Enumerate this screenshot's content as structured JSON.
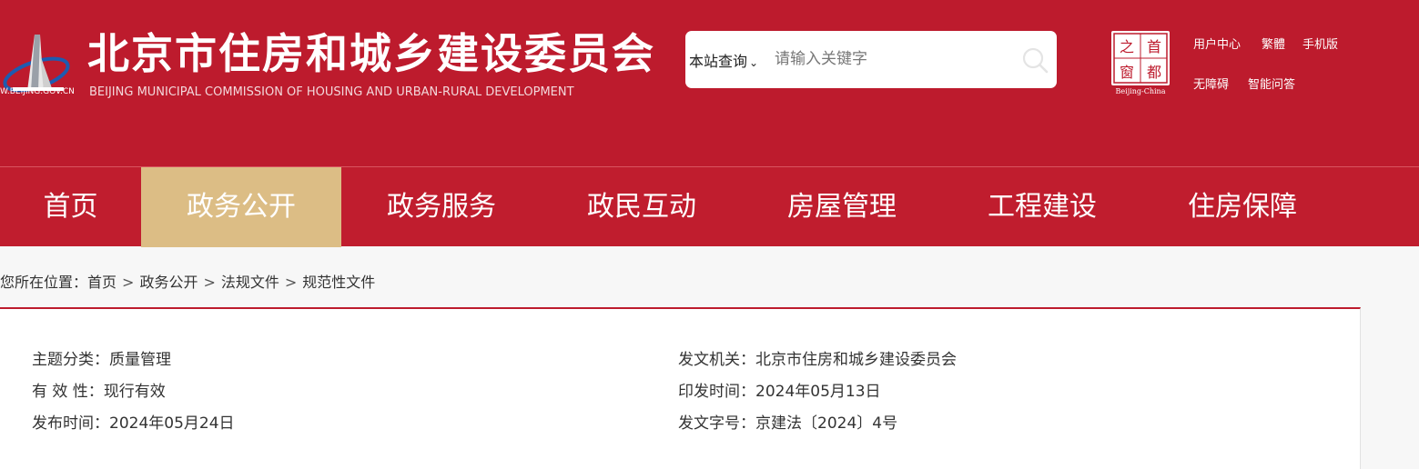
{
  "header": {
    "title": "北京市住房和城乡建设委员会",
    "subtitle": "BEIJING MUNICIPAL COMMISSION OF HOUSING AND URBAN-RURAL DEVELOPMENT",
    "emblem_url": "W.BEIJING.GOV.CN",
    "colors": {
      "brand": "#bd1b2d",
      "nav_active": "#dcbd85"
    }
  },
  "search": {
    "scope_label": "本站查询",
    "placeholder": "请输入关键字"
  },
  "capital_badge": {
    "chars": [
      "之",
      "首",
      "窗",
      "都"
    ],
    "caption": "Beijing-China"
  },
  "top_links": [
    "用户中心",
    "繁體",
    "手机版",
    "无障碍",
    "智能问答"
  ],
  "nav": {
    "items": [
      "首页",
      "政务公开",
      "政务服务",
      "政民互动",
      "房屋管理",
      "工程建设",
      "住房保障"
    ],
    "active_index": 1
  },
  "breadcrumb": {
    "prefix": "您所在位置：",
    "items": [
      "首页",
      "政务公开",
      "法规文件",
      "规范性文件"
    ],
    "separator": ">"
  },
  "document_meta": {
    "left": [
      {
        "label": "主题分类：",
        "value": "质量管理"
      },
      {
        "label": "有 效 性：",
        "value": "现行有效"
      },
      {
        "label": "发布时间：",
        "value": "2024年05月24日"
      }
    ],
    "right": [
      {
        "label": "发文机关：",
        "value": "北京市住房和城乡建设委员会"
      },
      {
        "label": "印发时间：",
        "value": "2024年05月13日"
      },
      {
        "label": "发文字号：",
        "value": "京建法〔2024〕4号"
      }
    ]
  }
}
